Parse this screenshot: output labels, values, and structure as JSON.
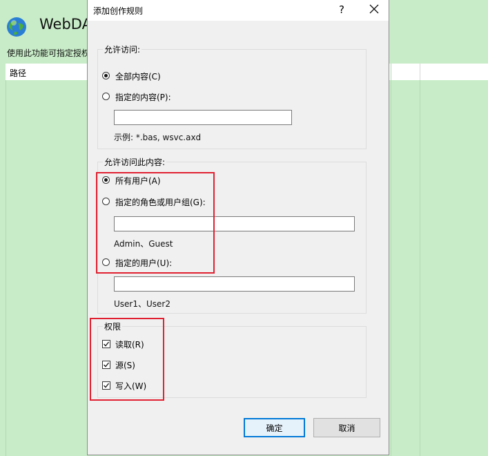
{
  "background": {
    "title": "WebDA",
    "description": "使用此功能可指定授权",
    "column_header": "路径"
  },
  "dialog": {
    "title": "添加创作规则",
    "help_label": "?",
    "allow_access": {
      "group_label": "允许访问:",
      "all_content_label": "全部内容(C)",
      "specified_content_label": "指定的内容(P):",
      "specified_content_value": "",
      "example": "示例: *.bas, wsvc.axd"
    },
    "allow_users": {
      "group_label": "允许访问此内容:",
      "all_users_label": "所有用户(A)",
      "roles_label": "指定的角色或用户组(G):",
      "roles_value": "",
      "roles_example": "Admin、Guest",
      "users_label": "指定的用户(U):",
      "users_value": "",
      "users_example": "User1、User2"
    },
    "permissions": {
      "group_label": "权限",
      "read_label": "读取(R)",
      "source_label": "源(S)",
      "write_label": "写入(W)"
    },
    "ok_label": "确定",
    "cancel_label": "取消"
  },
  "colors": {
    "background": "#c8ecc8",
    "highlight": "#e02030",
    "accent": "#0078d7"
  }
}
